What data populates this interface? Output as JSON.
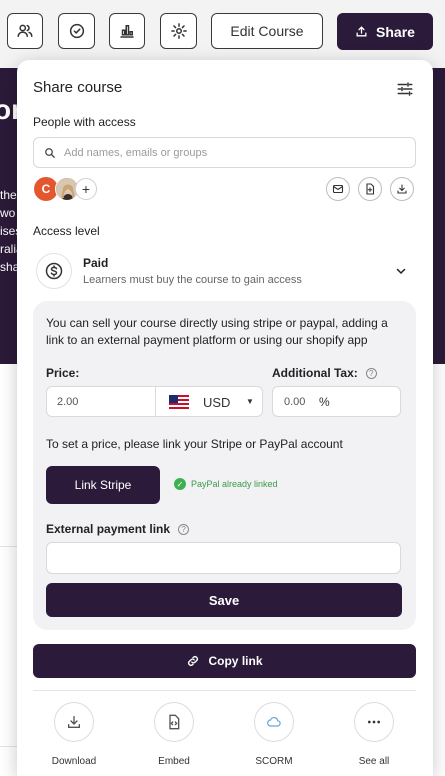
{
  "toolbar": {
    "edit_label": "Edit Course",
    "share_label": "Share"
  },
  "background": {
    "hero_fragment": "or",
    "hero_lines": [
      "the",
      "wo",
      "ises",
      "ralia",
      "sha"
    ]
  },
  "share": {
    "title": "Share course",
    "people_label": "People with access",
    "search_placeholder": "Add names, emails or groups",
    "avatar_initial": "C",
    "add_symbol": "+",
    "access_level_label": "Access level",
    "access": {
      "title": "Paid",
      "subtitle": "Learners must buy the course to gain access"
    },
    "pricing": {
      "description": "You can sell your course directly using stripe or paypal, adding a link to an external payment platform or using our shopify app",
      "price_label": "Price:",
      "price_value": "2.00",
      "currency": "USD",
      "tax_label": "Additional Tax:",
      "tax_value": "0.00",
      "tax_unit": "%",
      "link_note": "To set a price, please link your Stripe or PayPal account",
      "stripe_button": "Link Stripe",
      "paypal_status": "PayPal already linked",
      "external_label": "External payment link",
      "external_value": "",
      "save_label": "Save"
    },
    "copy_link_label": "Copy link",
    "actions": [
      {
        "label": "Download",
        "icon": "download-icon"
      },
      {
        "label": "Embed",
        "icon": "embed-file-icon"
      },
      {
        "label": "SCORM",
        "icon": "cloud-icon"
      },
      {
        "label": "See all",
        "icon": "more-icon"
      }
    ]
  },
  "colors": {
    "brand": "#2b1a39",
    "success": "#3fb04f"
  }
}
